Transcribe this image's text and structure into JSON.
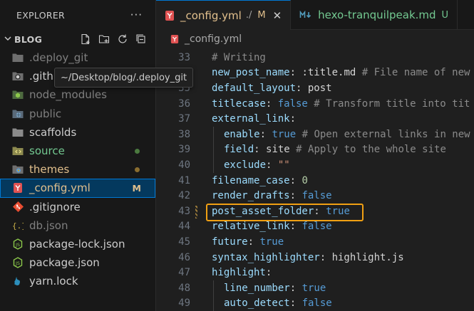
{
  "sidebar": {
    "title": "EXPLORER",
    "more": "···",
    "section": "BLOG",
    "items": [
      {
        "label": ".deploy_git",
        "icon": "folder-icon",
        "state": "dim"
      },
      {
        "label": ".github",
        "icon": "github-folder-icon",
        "state": "normal"
      },
      {
        "label": "node_modules",
        "icon": "node-folder-icon",
        "state": "dim"
      },
      {
        "label": "public",
        "icon": "public-folder-icon",
        "state": "dim"
      },
      {
        "label": "scaffolds",
        "icon": "folder-icon",
        "state": "normal"
      },
      {
        "label": "source",
        "icon": "source-folder-icon",
        "state": "green"
      },
      {
        "label": "themes",
        "icon": "themes-folder-icon",
        "state": "yellow"
      },
      {
        "label": "_config.yml",
        "icon": "yaml-icon",
        "state": "selected",
        "badge": "M"
      },
      {
        "label": ".gitignore",
        "icon": "git-icon",
        "state": "normal"
      },
      {
        "label": "db.json",
        "icon": "json-icon",
        "state": "dim"
      },
      {
        "label": "package-lock.json",
        "icon": "nodejs-icon",
        "state": "normal"
      },
      {
        "label": "package.json",
        "icon": "nodejs-icon",
        "state": "normal"
      },
      {
        "label": "yarn.lock",
        "icon": "yarn-icon",
        "state": "normal"
      }
    ],
    "tooltip": "~/Desktop/blog/.deploy_git"
  },
  "tabs": [
    {
      "name": "_config.yml",
      "desc": "./",
      "status": "M",
      "close": "✕",
      "active": true
    },
    {
      "name": "hexo-tranquilpeak.md",
      "status": "U",
      "active": false
    }
  ],
  "breadcrumb": "_config.yml",
  "code": [
    {
      "n": "33",
      "indent": 0,
      "tokens": [
        [
          "cmg",
          "# Writing"
        ]
      ]
    },
    {
      "n": "34",
      "indent": 0,
      "tokens": [
        [
          "k",
          "new_post_name"
        ],
        [
          "plain",
          ": "
        ],
        [
          "plain",
          ":title.md"
        ],
        [
          "cmg",
          " # File name of new"
        ]
      ]
    },
    {
      "n": "35",
      "indent": 0,
      "tokens": [
        [
          "k",
          "default_layout"
        ],
        [
          "plain",
          ": "
        ],
        [
          "plain",
          "post"
        ]
      ]
    },
    {
      "n": "36",
      "indent": 0,
      "tokens": [
        [
          "k",
          "titlecase"
        ],
        [
          "plain",
          ": "
        ],
        [
          "kw",
          "false"
        ],
        [
          "cmg",
          " # Transform title into tit"
        ]
      ]
    },
    {
      "n": "37",
      "indent": 0,
      "tokens": [
        [
          "k",
          "external_link"
        ],
        [
          "plain",
          ":"
        ]
      ]
    },
    {
      "n": "38",
      "indent": 1,
      "tokens": [
        [
          "k",
          "enable"
        ],
        [
          "plain",
          ": "
        ],
        [
          "kw",
          "true"
        ],
        [
          "cmg",
          " # Open external links in new"
        ]
      ]
    },
    {
      "n": "39",
      "indent": 1,
      "tokens": [
        [
          "k",
          "field"
        ],
        [
          "plain",
          ": "
        ],
        [
          "plain",
          "site"
        ],
        [
          "cmg",
          " # Apply to the whole site"
        ]
      ]
    },
    {
      "n": "40",
      "indent": 1,
      "tokens": [
        [
          "k",
          "exclude"
        ],
        [
          "plain",
          ": "
        ],
        [
          "str",
          "\"\""
        ]
      ]
    },
    {
      "n": "41",
      "indent": 0,
      "tokens": [
        [
          "k",
          "filename_case"
        ],
        [
          "plain",
          ": "
        ],
        [
          "num",
          "0"
        ]
      ]
    },
    {
      "n": "42",
      "indent": 0,
      "tokens": [
        [
          "k",
          "render_drafts"
        ],
        [
          "plain",
          ": "
        ],
        [
          "kw",
          "false"
        ]
      ]
    },
    {
      "n": "43",
      "indent": 0,
      "tokens": [
        [
          "k",
          "post_asset_folder"
        ],
        [
          "plain",
          ": "
        ],
        [
          "kw",
          "true"
        ]
      ]
    },
    {
      "n": "44",
      "indent": 0,
      "tokens": [
        [
          "k",
          "relative_link"
        ],
        [
          "plain",
          ": "
        ],
        [
          "kw",
          "false"
        ]
      ]
    },
    {
      "n": "45",
      "indent": 0,
      "tokens": [
        [
          "k",
          "future"
        ],
        [
          "plain",
          ": "
        ],
        [
          "kw",
          "true"
        ]
      ]
    },
    {
      "n": "46",
      "indent": 0,
      "tokens": [
        [
          "k",
          "syntax_highlighter"
        ],
        [
          "plain",
          ": "
        ],
        [
          "plain",
          "highlight.js"
        ]
      ]
    },
    {
      "n": "47",
      "indent": 0,
      "tokens": [
        [
          "k",
          "highlight"
        ],
        [
          "plain",
          ":"
        ]
      ]
    },
    {
      "n": "48",
      "indent": 1,
      "tokens": [
        [
          "k",
          "line_number"
        ],
        [
          "plain",
          ": "
        ],
        [
          "kw",
          "true"
        ]
      ]
    },
    {
      "n": "49",
      "indent": 1,
      "tokens": [
        [
          "k",
          "auto_detect"
        ],
        [
          "plain",
          ": "
        ],
        [
          "kw",
          "false"
        ]
      ]
    }
  ],
  "colors": {
    "accent": "#0078d4",
    "highlight": "#f0a013",
    "modified": "#e2c08d",
    "untracked": "#73c991"
  }
}
